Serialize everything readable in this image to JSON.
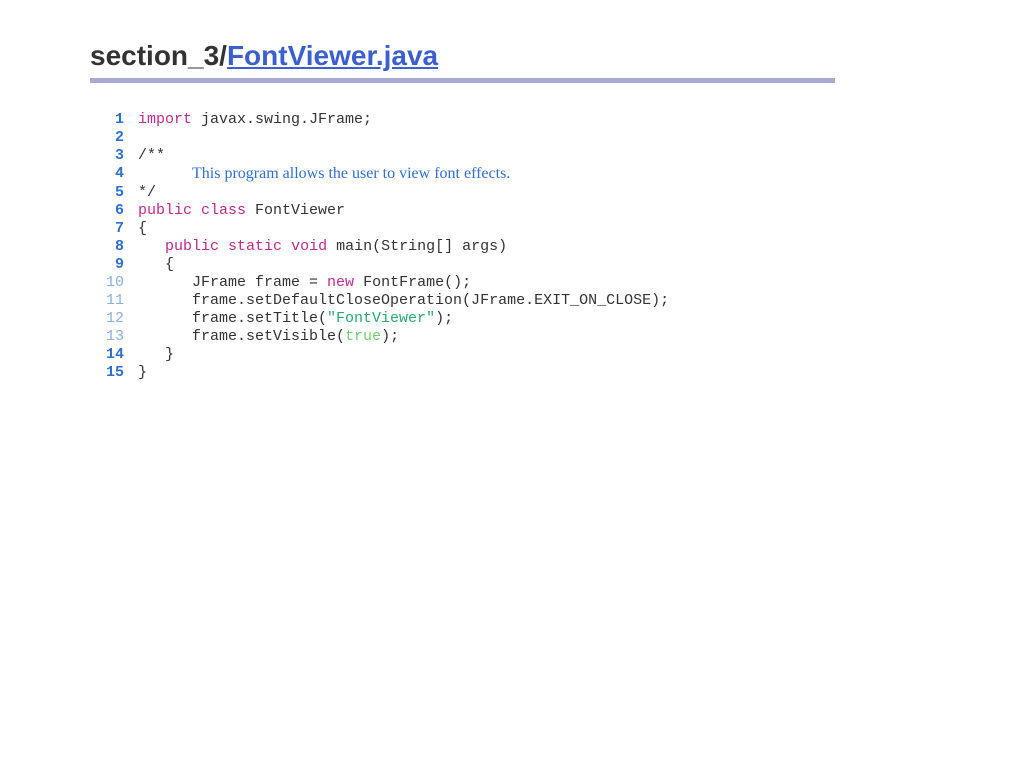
{
  "title_prefix": "section_3/",
  "title_link": "FontViewer.java",
  "lines": [
    {
      "n": "1",
      "faded": false
    },
    {
      "n": "2",
      "faded": false
    },
    {
      "n": "3",
      "faded": false
    },
    {
      "n": "4",
      "faded": false
    },
    {
      "n": "5",
      "faded": false
    },
    {
      "n": "6",
      "faded": false
    },
    {
      "n": "7",
      "faded": false
    },
    {
      "n": "8",
      "faded": false
    },
    {
      "n": "9",
      "faded": false
    },
    {
      "n": "10",
      "faded": true
    },
    {
      "n": "11",
      "faded": true
    },
    {
      "n": "12",
      "faded": true
    },
    {
      "n": "13",
      "faded": true
    },
    {
      "n": "14",
      "faded": false
    },
    {
      "n": "15",
      "faded": false
    }
  ],
  "tok": {
    "import": "import",
    "space": " ",
    "javax": "javax.swing.JFrame;",
    "cmt_open": "/**",
    "doc_indent": "      ",
    "doc_text": "This program allows the user to view font effects.",
    "cmt_close": "*/",
    "public": "public",
    "class": "class",
    "fontviewer": " FontViewer",
    "brace_open": "{",
    "indent1": "   ",
    "static": "static",
    "void": "void",
    "main_sig": " main(String[] args)",
    "brace_open2": "{",
    "indent2": "      ",
    "jframe_decl": "JFrame frame = ",
    "new": "new",
    "fontframe": " FontFrame();",
    "setdefault": "frame.setDefaultCloseOperation(JFrame.EXIT_ON_CLOSE);",
    "settitle_a": "frame.setTitle(",
    "str_fv": "\"FontViewer\"",
    "settitle_b": ");",
    "setvisible_a": "frame.setVisible(",
    "true": "true",
    "setvisible_b": ");",
    "brace_close2": "}",
    "brace_close": "}"
  }
}
